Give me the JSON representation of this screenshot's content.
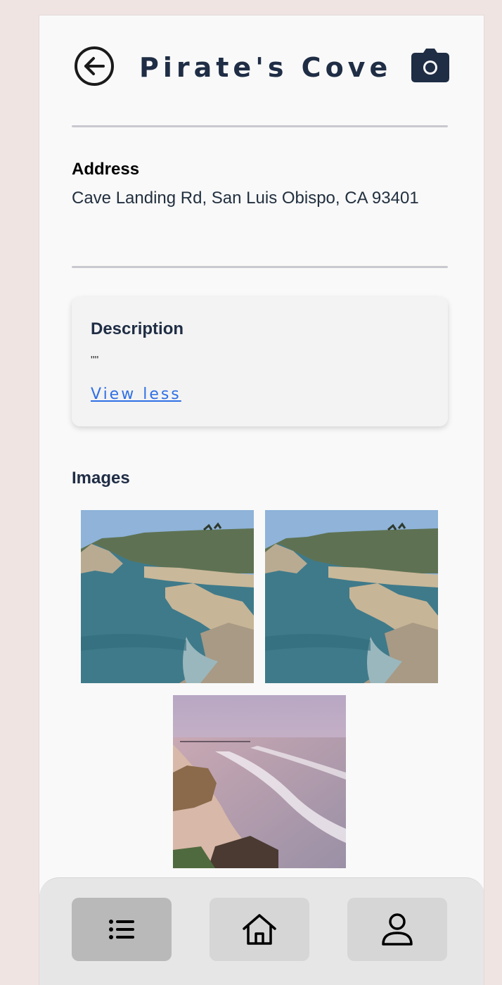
{
  "header": {
    "title": "Pirate's Cove",
    "back_icon": "arrow-left-circle-icon",
    "camera_icon": "camera-icon",
    "title_color": "#1f2d45"
  },
  "address": {
    "label": "Address",
    "value": "Cave Landing Rd, San Luis Obispo, CA 93401"
  },
  "description": {
    "label": "Description",
    "text": "\"\"",
    "toggle_label": "View less",
    "link_color": "#2f6fe5"
  },
  "images": {
    "label": "Images",
    "items": [
      {
        "icon": "coastal-cove-photo"
      },
      {
        "icon": "coastal-cove-photo"
      },
      {
        "icon": "sunset-beach-photo"
      }
    ]
  },
  "bottom_nav": {
    "items": [
      {
        "icon": "list-icon",
        "active": true
      },
      {
        "icon": "home-icon",
        "active": false
      },
      {
        "icon": "user-icon",
        "active": false
      }
    ]
  }
}
